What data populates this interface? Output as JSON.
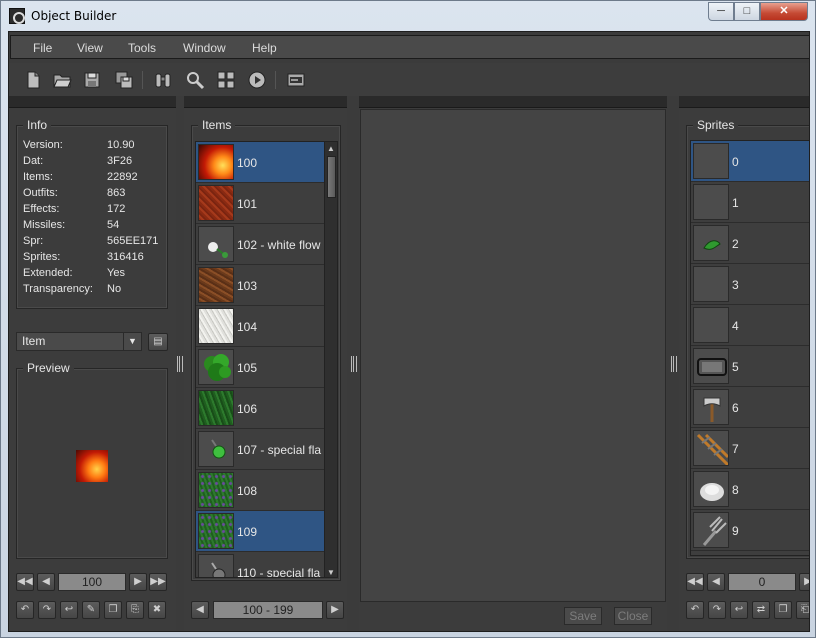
{
  "window": {
    "title": "Object Builder",
    "min_label": "─",
    "max_label": "□",
    "close_label": "✕"
  },
  "menu": [
    "File",
    "View",
    "Tools",
    "Window",
    "Help"
  ],
  "toolbar_icons": [
    "new-file-icon",
    "open-folder-icon",
    "save-icon",
    "save-as-icon",
    "binoculars-icon",
    "search-icon",
    "grid-icon",
    "play-icon",
    "console-icon"
  ],
  "info": {
    "title": "Info",
    "rows": [
      {
        "label": "Version:",
        "value": "10.90"
      },
      {
        "label": "Dat:",
        "value": "3F26"
      },
      {
        "label": "Items:",
        "value": "22892"
      },
      {
        "label": "Outfits:",
        "value": "863"
      },
      {
        "label": "Effects:",
        "value": "172"
      },
      {
        "label": "Missiles:",
        "value": "54"
      },
      {
        "label": "Spr:",
        "value": "565EE171"
      },
      {
        "label": "Sprites:",
        "value": "316416"
      },
      {
        "label": "Extended:",
        "value": "Yes"
      },
      {
        "label": "Transparency:",
        "value": "No"
      }
    ]
  },
  "category_select": {
    "value": "Item"
  },
  "preview": {
    "title": "Preview",
    "id_value": "100"
  },
  "items": {
    "title": "Items",
    "rows": [
      {
        "label": "100",
        "selected": true,
        "thumb": "fire"
      },
      {
        "label": "101",
        "selected": false,
        "thumb": "dirt-red"
      },
      {
        "label": "102 - white flow",
        "selected": false,
        "thumb": "flower"
      },
      {
        "label": "103",
        "selected": false,
        "thumb": "dirt-brown"
      },
      {
        "label": "104",
        "selected": false,
        "thumb": "snow"
      },
      {
        "label": "105",
        "selected": false,
        "thumb": "bush"
      },
      {
        "label": "106",
        "selected": false,
        "thumb": "grass"
      },
      {
        "label": "107 - special fla",
        "selected": false,
        "thumb": "flask-green"
      },
      {
        "label": "108",
        "selected": false,
        "thumb": "grass-dots"
      },
      {
        "label": "109",
        "selected": true,
        "thumb": "grass-dots"
      },
      {
        "label": "110 - special fla",
        "selected": false,
        "thumb": "flask-grey"
      }
    ],
    "range_label": "100 - 199"
  },
  "editor": {
    "save_label": "Save",
    "close_label": "Close"
  },
  "sprites": {
    "title": "Sprites",
    "rows": [
      {
        "label": "0",
        "selected": true,
        "thumb": "empty"
      },
      {
        "label": "1",
        "selected": false,
        "thumb": "empty"
      },
      {
        "label": "2",
        "selected": false,
        "thumb": "leaf"
      },
      {
        "label": "3",
        "selected": false,
        "thumb": "empty"
      },
      {
        "label": "4",
        "selected": false,
        "thumb": "empty"
      },
      {
        "label": "5",
        "selected": false,
        "thumb": "plate"
      },
      {
        "label": "6",
        "selected": false,
        "thumb": "axe"
      },
      {
        "label": "7",
        "selected": false,
        "thumb": "ladder"
      },
      {
        "label": "8",
        "selected": false,
        "thumb": "pile"
      },
      {
        "label": "9",
        "selected": false,
        "thumb": "fork"
      }
    ],
    "id_value": "0"
  },
  "colors": {
    "selection": "#2f5584",
    "panel": "#3c3c3c"
  }
}
